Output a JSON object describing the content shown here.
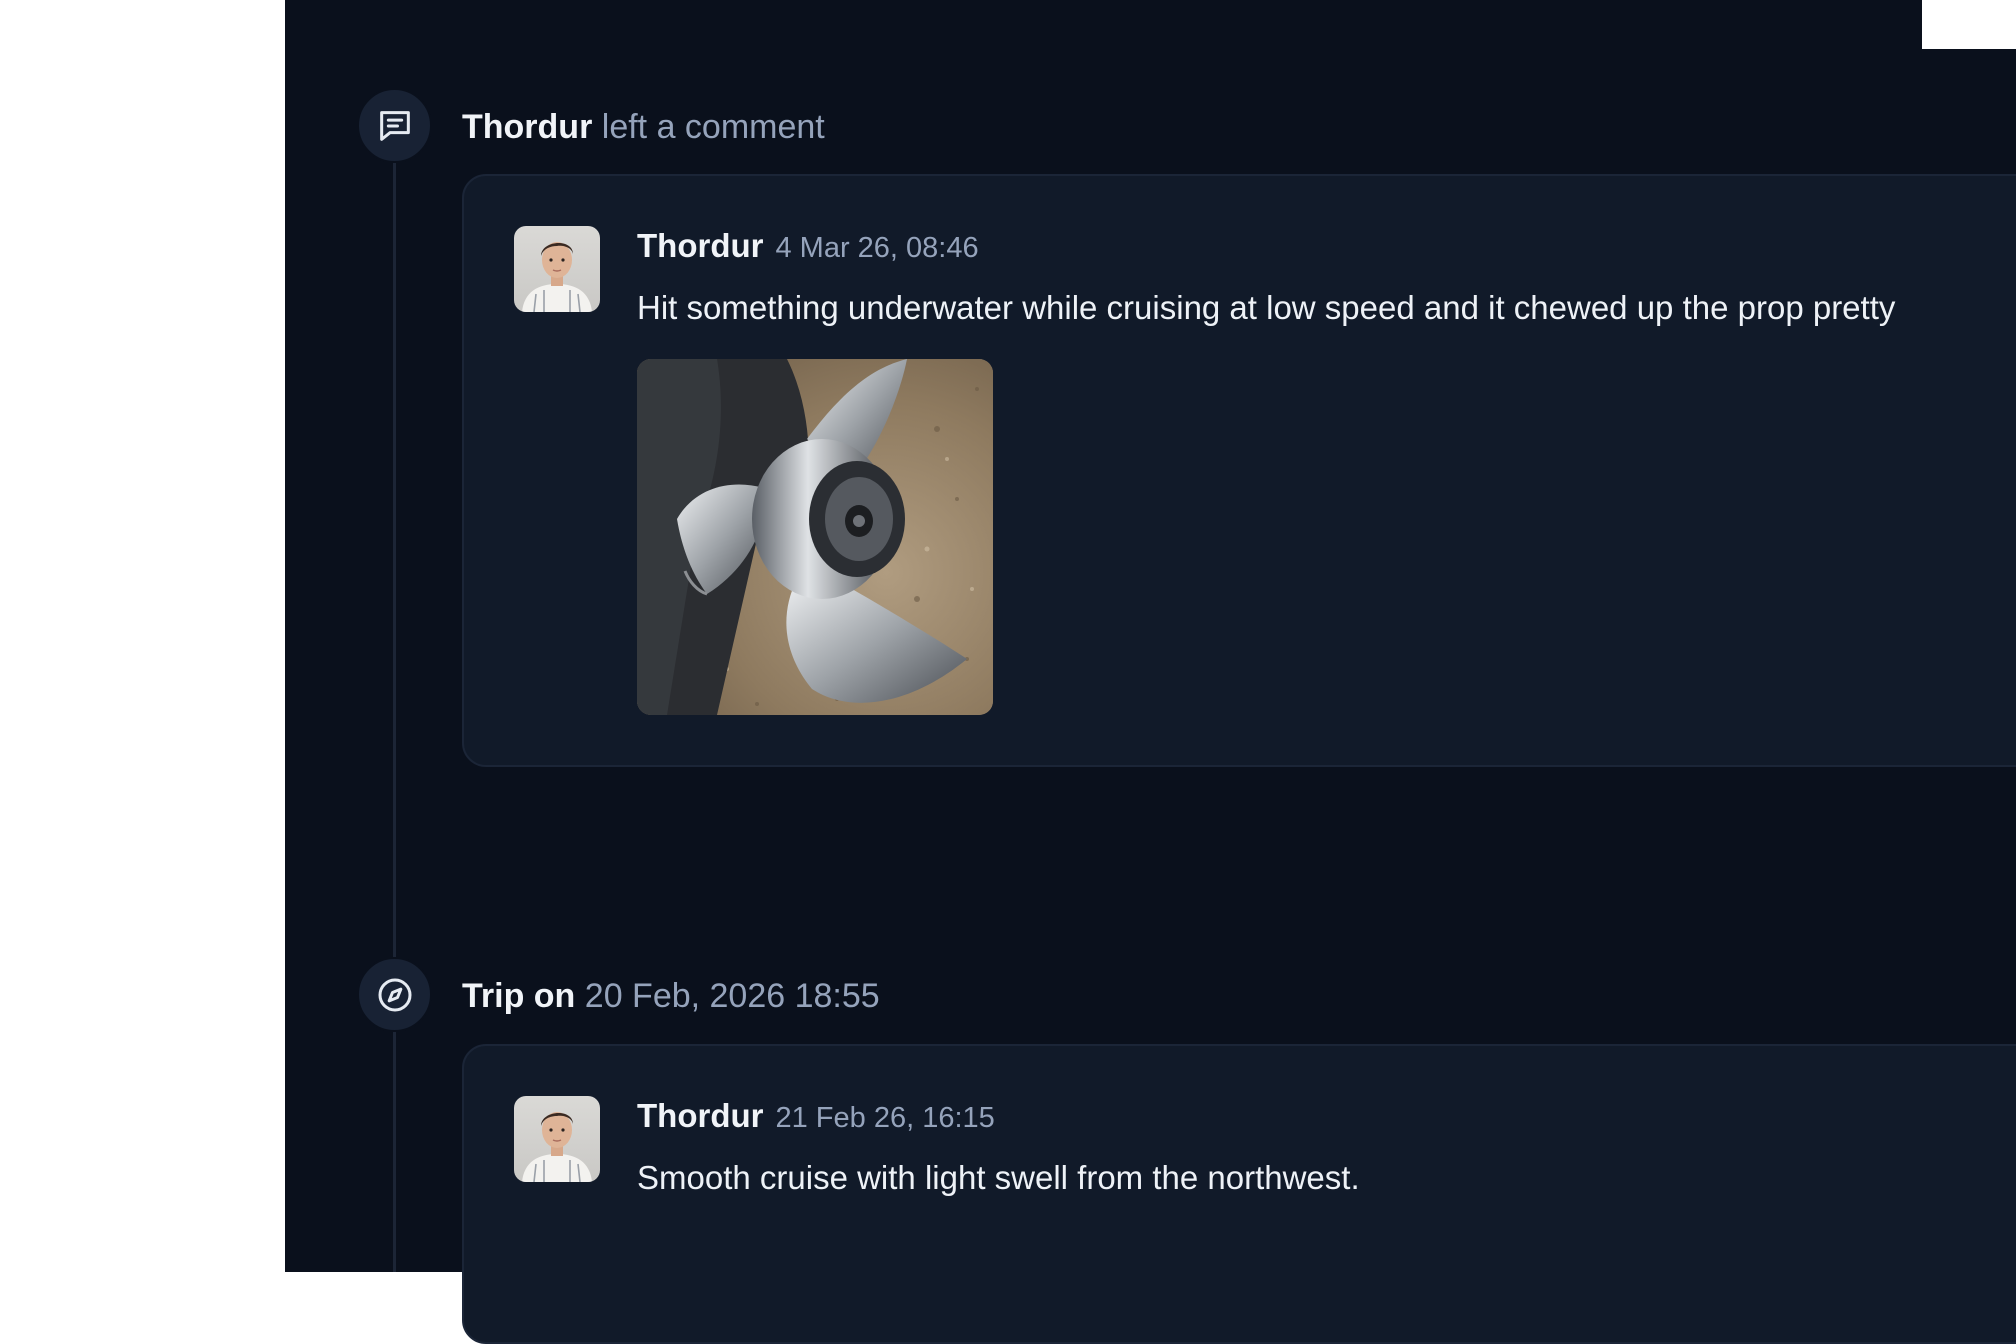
{
  "timeline": [
    {
      "icon": "comment-icon",
      "header_actor": "Thordur",
      "header_action": "left a comment",
      "comment": {
        "author": "Thordur",
        "timestamp": "4 Mar 26, 08:46",
        "text": "Hit something underwater while cruising at low speed and it chewed up the prop pretty",
        "attachment": "damaged-propeller-photo"
      }
    },
    {
      "icon": "compass-icon",
      "header_label": "Trip on",
      "header_date": "20 Feb, 2026 18:55",
      "comment": {
        "author": "Thordur",
        "timestamp": "21 Feb 26, 16:15",
        "text": "Smooth cruise with light swell from the northwest."
      }
    }
  ],
  "colors": {
    "background": "#0a101c",
    "card": "#111a29",
    "text_primary": "#f1f4f8",
    "text_muted": "#95a3bb"
  }
}
